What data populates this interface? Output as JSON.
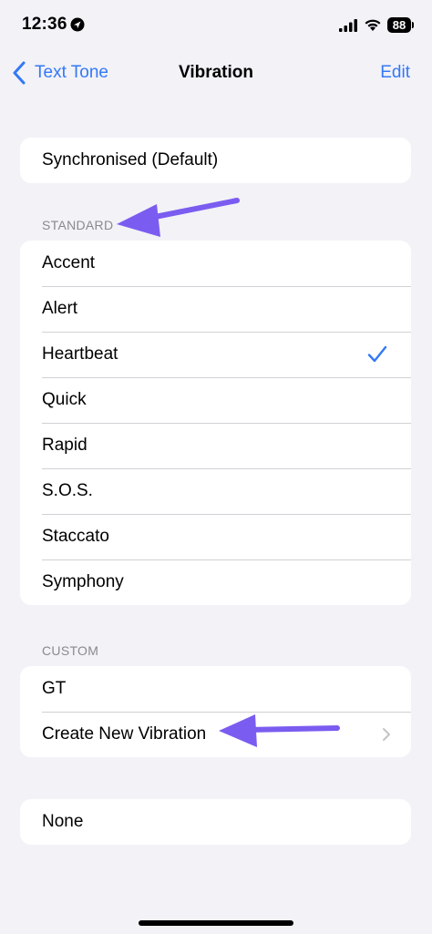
{
  "status_bar": {
    "time": "12:36",
    "battery": "88"
  },
  "nav": {
    "back_label": "Text Tone",
    "title": "Vibration",
    "edit_label": "Edit"
  },
  "default_option": "Synchronised (Default)",
  "standard": {
    "header": "STANDARD",
    "items": [
      "Accent",
      "Alert",
      "Heartbeat",
      "Quick",
      "Rapid",
      "S.O.S.",
      "Staccato",
      "Symphony"
    ],
    "selected": "Heartbeat"
  },
  "custom": {
    "header": "CUSTOM",
    "items": [
      "GT",
      "Create New Vibration"
    ]
  },
  "none_option": "None",
  "colors": {
    "accent": "#3478f6",
    "annotation_arrow": "#7b5cf0",
    "background": "#f2f2f7"
  }
}
